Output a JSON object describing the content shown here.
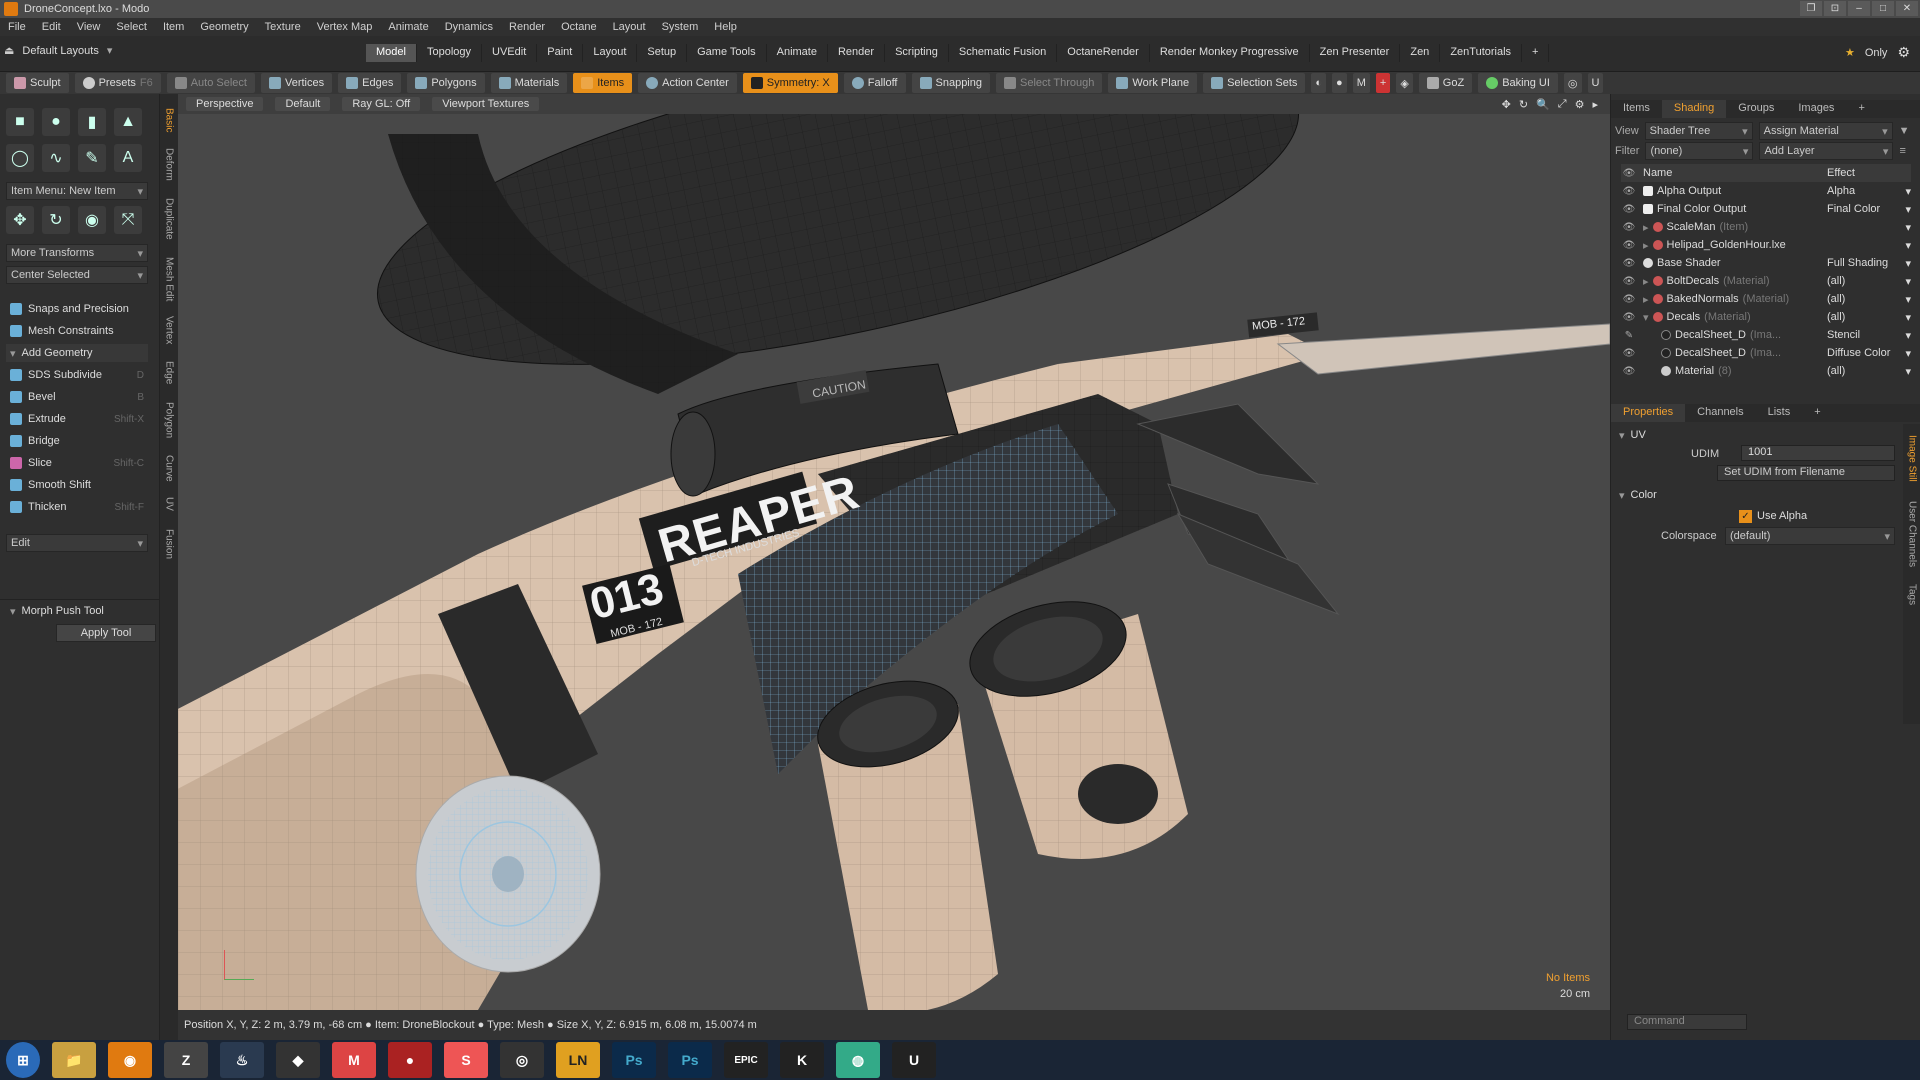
{
  "window": {
    "title": "DroneConcept.lxo - Modo"
  },
  "menu": [
    "File",
    "Edit",
    "View",
    "Select",
    "Item",
    "Geometry",
    "Texture",
    "Vertex Map",
    "Animate",
    "Dynamics",
    "Render",
    "Octane",
    "Layout",
    "System",
    "Help"
  ],
  "layout_selector": "Default Layouts",
  "layout_tabs": [
    "Model",
    "Topology",
    "UVEdit",
    "Paint",
    "Layout",
    "Setup",
    "Game Tools",
    "Animate",
    "Render",
    "Scripting",
    "Schematic Fusion",
    "OctaneRender",
    "Render Monkey Progressive",
    "Zen Presenter",
    "Zen",
    "ZenTutorials"
  ],
  "only_label": "Only",
  "toolbar": {
    "sculpt": "Sculpt",
    "presets": "Presets",
    "presets_key": "F6",
    "auto_select": "Auto Select",
    "vertices": "Vertices",
    "edges": "Edges",
    "polygons": "Polygons",
    "materials": "Materials",
    "items": "Items",
    "action_center": "Action Center",
    "symmetry": "Symmetry: X",
    "falloff": "Falloff",
    "snapping": "Snapping",
    "select_through": "Select Through",
    "work_plane": "Work Plane",
    "selection_sets": "Selection Sets",
    "goz": "GoZ",
    "baking_ui": "Baking UI"
  },
  "left": {
    "item_menu": "Item Menu: New Item",
    "more_transforms": "More Transforms",
    "center_selected": "Center Selected",
    "snaps": "Snaps and Precision",
    "mesh_constraints": "Mesh Constraints",
    "add_geometry": "Add Geometry",
    "tools": [
      {
        "label": "SDS Subdivide",
        "key": "D"
      },
      {
        "label": "Bevel",
        "key": "B"
      },
      {
        "label": "Extrude",
        "key": "Shift-X"
      },
      {
        "label": "Bridge",
        "key": ""
      },
      {
        "label": "Slice",
        "key": "Shift-C"
      },
      {
        "label": "Smooth Shift",
        "key": ""
      },
      {
        "label": "Thicken",
        "key": "Shift-F"
      }
    ],
    "edit": "Edit",
    "morph_push_tool": "Morph Push Tool",
    "apply_tool": "Apply Tool",
    "vtabs": [
      "Basic",
      "Deform",
      "Duplicate",
      "Mesh Edit",
      "Vertex",
      "Edge",
      "Polygon",
      "Curve",
      "UV",
      "Fusion"
    ]
  },
  "viewport": {
    "bar": [
      "Perspective",
      "Default",
      "Ray GL: Off",
      "Viewport Textures"
    ],
    "decal_text": "REAPER",
    "decal_sub": "D-TECH INDUSTRIES",
    "number": "013",
    "number_sub": "MOB - 172",
    "caution": "CAUTION",
    "wing_tag": "MOB - 172",
    "no_items": "No Items",
    "scale": "20 cm"
  },
  "status": {
    "text": "Position X, Y, Z:  2 m, 3.79 m, -68 cm  ●  Item:  DroneBlockout  ●  Type:  Mesh  ●  Size X, Y, Z:  6.915 m, 6.08 m, 15.0074 m"
  },
  "right": {
    "tabs": [
      "Items",
      "Shading",
      "Groups",
      "Images"
    ],
    "view_label": "View",
    "view_value": "Shader Tree",
    "assign_material": "Assign Material",
    "filter_label": "Filter",
    "filter_value": "(none)",
    "add_layer": "Add Layer",
    "col_name": "Name",
    "col_effect": "Effect",
    "rows": [
      {
        "name": "Alpha Output",
        "sub": "",
        "effect": "Alpha"
      },
      {
        "name": "Final Color Output",
        "sub": "",
        "effect": "Final Color"
      },
      {
        "name": "ScaleMan",
        "sub": "(Item)",
        "effect": ""
      },
      {
        "name": "Helipad_GoldenHour.lxe",
        "sub": "",
        "effect": ""
      },
      {
        "name": "Base Shader",
        "sub": "",
        "effect": "Full Shading"
      },
      {
        "name": "BoltDecals",
        "sub": "(Material)",
        "effect": "(all)"
      },
      {
        "name": "BakedNormals",
        "sub": "(Material)",
        "effect": "(all)"
      },
      {
        "name": "Decals",
        "sub": "(Material)",
        "effect": "(all)"
      },
      {
        "name": "DecalSheet_D",
        "sub": "(Ima...",
        "effect": "Stencil"
      },
      {
        "name": "DecalSheet_D",
        "sub": "(Ima...",
        "effect": "Diffuse Color"
      },
      {
        "name": "Material",
        "sub": "(8)",
        "effect": "(all)"
      }
    ],
    "props_tabs": [
      "Properties",
      "Channels",
      "Lists"
    ],
    "uv_section": "UV",
    "udim_label": "UDIM",
    "udim_value": "1001",
    "set_udim": "Set UDIM from Filename",
    "color_section": "Color",
    "use_alpha": "Use Alpha",
    "colorspace_label": "Colorspace",
    "colorspace_value": "(default)",
    "side_tabs": [
      "Image Still",
      "User Channels",
      "Tags"
    ],
    "command": "Command"
  },
  "taskbar": [
    "start",
    "explorer",
    "modo",
    "zbrush",
    "steam",
    "unity",
    "marmoset",
    "substance-red",
    "substance-orange",
    "obs",
    "ln",
    "photoshop-cc",
    "photoshop",
    "epic",
    "unreal-k",
    "chrome",
    "unreal"
  ],
  "colors": {
    "accent": "#e8901a",
    "hull": "#d9c2ad",
    "dark": "#2a2a2a",
    "wire": "#7fb6d8"
  }
}
